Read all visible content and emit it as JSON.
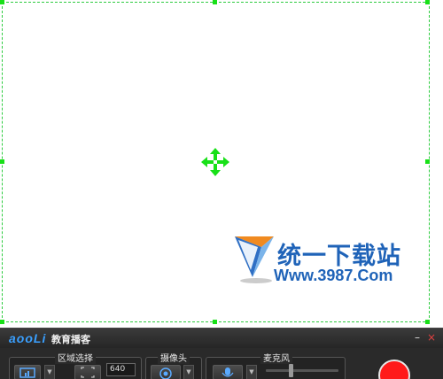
{
  "capture": {
    "move_icon": "move-arrows-icon",
    "color": "#18e018"
  },
  "watermark": {
    "logo_icon": "triangle-logo-icon",
    "title": "统一下载站",
    "url": "Www.3987.Com"
  },
  "toolbar": {
    "logo": "aooLi",
    "app_title": "教育播客",
    "minimize": "–",
    "close": "×",
    "region_label": "区域选择",
    "region_width": "640",
    "camera_label": "摄像头",
    "mic_label": "麦克风",
    "record_color": "#ff1a1a"
  }
}
